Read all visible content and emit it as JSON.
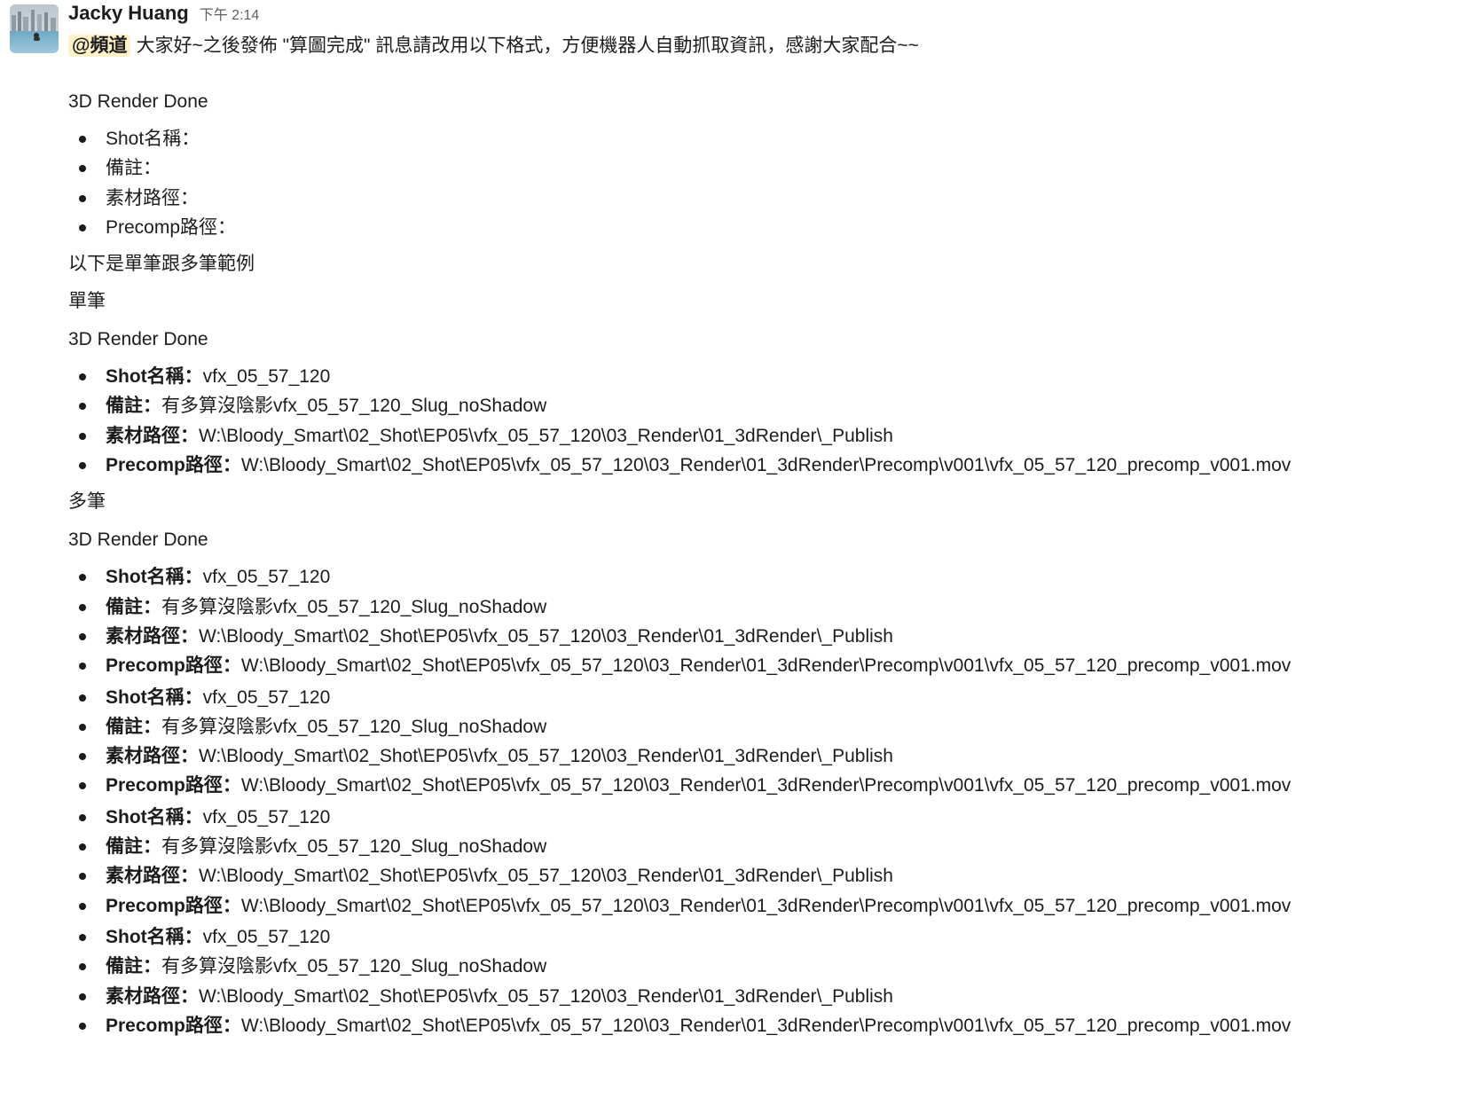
{
  "message": {
    "sender": "Jacky Huang",
    "timestamp": "下午 2:14",
    "mention": "@頻道",
    "intro": "大家好~之後發佈 \"算圖完成\" 訊息請改用以下格式，方便機器人自動抓取資訊，感謝大家配合~~",
    "template": {
      "heading": "3D Render Done",
      "items": [
        "Shot名稱：",
        "備註：",
        "素材路徑：",
        "Precomp路徑："
      ]
    },
    "examples_intro": "以下是單筆跟多筆範例",
    "single_label": "單筆",
    "single_heading": "3D Render Done",
    "multi_label": "多筆",
    "multi_heading": "3D Render Done",
    "entry": {
      "shot_label": "Shot名稱：",
      "shot_value": "vfx_05_57_120",
      "note_label": "備註：",
      "note_value": "有多算沒陰影vfx_05_57_120_Slug_noShadow",
      "asset_label": "素材路徑：",
      "asset_value": "W:\\Bloody_Smart\\02_Shot\\EP05\\vfx_05_57_120\\03_Render\\01_3dRender\\_Publish",
      "precomp_label": "Precomp路徑：",
      "precomp_value": "W:\\Bloody_Smart\\02_Shot\\EP05\\vfx_05_57_120\\03_Render\\01_3dRender\\Precomp\\v001\\vfx_05_57_120_precomp_v001.mov"
    }
  }
}
